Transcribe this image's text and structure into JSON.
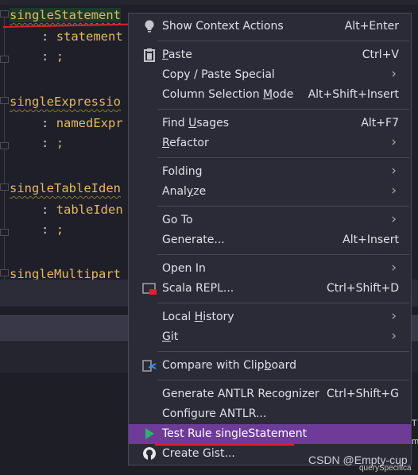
{
  "editor": {
    "lines": [
      {
        "text": "singleStatement",
        "kind": "rule"
      },
      {
        "text": ": statement",
        "kind": "sub"
      },
      {
        "text": ";",
        "kind": "punct"
      },
      {
        "text": "singleExpressio",
        "kind": "rule"
      },
      {
        "text": ": namedExpr",
        "kind": "sub"
      },
      {
        "text": ";",
        "kind": "punct"
      },
      {
        "text": "singleTableIden",
        "kind": "rule"
      },
      {
        "text": ": tableIden",
        "kind": "sub"
      },
      {
        "text": ";",
        "kind": "punct"
      },
      {
        "text": "singleMultipart",
        "kind": "rule"
      }
    ]
  },
  "menu": {
    "groups": [
      [
        {
          "label": "Show Context Actions",
          "shortcut": "Alt+Enter",
          "icon": "lightbulb-icon"
        }
      ],
      [
        {
          "label": "Paste",
          "mnemonic": 0,
          "shortcut": "Ctrl+V",
          "icon": "clipboard-icon"
        },
        {
          "label": "Copy / Paste Special",
          "submenu": true
        },
        {
          "label": "Column Selection Mode",
          "mnemonic": 17,
          "shortcut": "Alt+Shift+Insert"
        }
      ],
      [
        {
          "label": "Find Usages",
          "mnemonic": 5,
          "shortcut": "Alt+F7"
        },
        {
          "label": "Refactor",
          "mnemonic": 0,
          "submenu": true
        }
      ],
      [
        {
          "label": "Folding",
          "submenu": true
        },
        {
          "label": "Analyze",
          "mnemonic": 4,
          "submenu": true
        }
      ],
      [
        {
          "label": "Go To",
          "submenu": true
        },
        {
          "label": "Generate...",
          "shortcut": "Alt+Insert"
        }
      ],
      [
        {
          "label": "Open In",
          "submenu": true
        },
        {
          "label": "Scala REPL...",
          "shortcut": "Ctrl+Shift+D",
          "icon": "scala-repl-icon"
        }
      ],
      [
        {
          "label": "Local History",
          "mnemonic": 6,
          "submenu": true
        },
        {
          "label": "Git",
          "mnemonic": 0,
          "submenu": true
        }
      ],
      [
        {
          "label": "Compare with Clipboard",
          "mnemonic": 17,
          "icon": "compare-clipboard-icon"
        }
      ],
      [
        {
          "label": "Generate ANTLR Recognizer",
          "shortcut": "Ctrl+Shift+G"
        },
        {
          "label": "Configure ANTLR..."
        },
        {
          "label": "Test Rule singleStatement",
          "icon": "play-icon",
          "selected": true
        },
        {
          "label": "Create Gist...",
          "icon": "github-icon"
        }
      ]
    ]
  },
  "side_text": [
    "T",
    "m"
  ],
  "bottom_text": "querySpecifica",
  "watermark": "CSDN @Empty-cup",
  "colors": {
    "selection": "#6e3b98",
    "accent_red": "#e0202a",
    "rule_text": "#e6b863"
  }
}
